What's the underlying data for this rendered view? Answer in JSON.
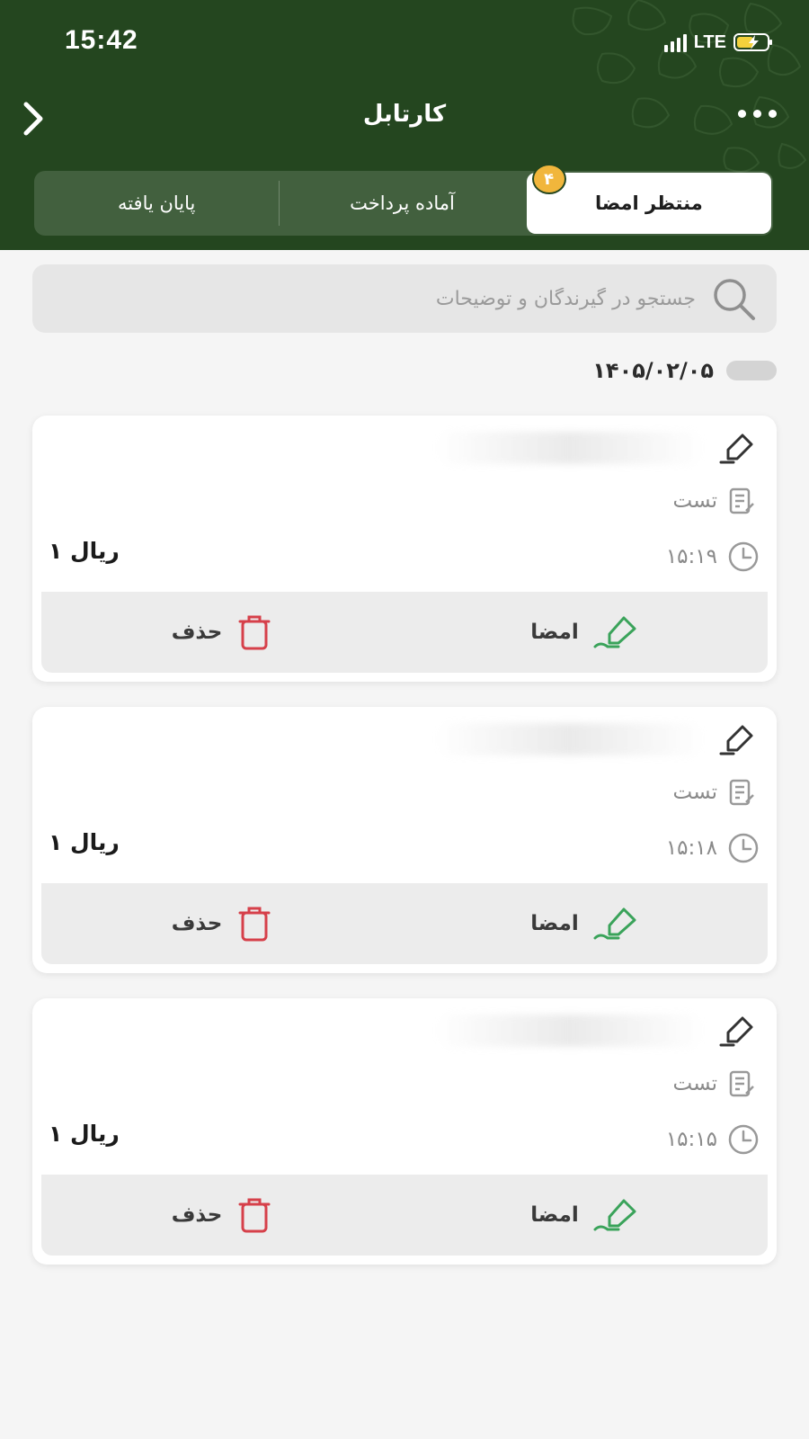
{
  "status_bar": {
    "time": "15:42",
    "network": "LTE"
  },
  "header": {
    "title": "کارتابل"
  },
  "tabs": [
    {
      "label": "منتظر امضا",
      "badge": "۴",
      "active": true
    },
    {
      "label": "آماده پرداخت",
      "active": false
    },
    {
      "label": "پایان یافته",
      "active": false
    }
  ],
  "search": {
    "placeholder": "جستجو در گیرندگان و توضیحات"
  },
  "date_group": {
    "date": "۱۴۰۵/۰۲/۰۵"
  },
  "actions": {
    "sign_label": "امضا",
    "delete_label": "حذف"
  },
  "cards": [
    {
      "description": "تست",
      "time": "۱۵:۱۹",
      "amount": "۱ ریال"
    },
    {
      "description": "تست",
      "time": "۱۵:۱۸",
      "amount": "۱ ریال"
    },
    {
      "description": "تست",
      "time": "۱۵:۱۵",
      "amount": "۱ ریال"
    }
  ],
  "colors": {
    "header": "#24461f",
    "badge": "#f1b63c",
    "sign_green": "#3aa35a",
    "delete_red": "#d6404a"
  }
}
